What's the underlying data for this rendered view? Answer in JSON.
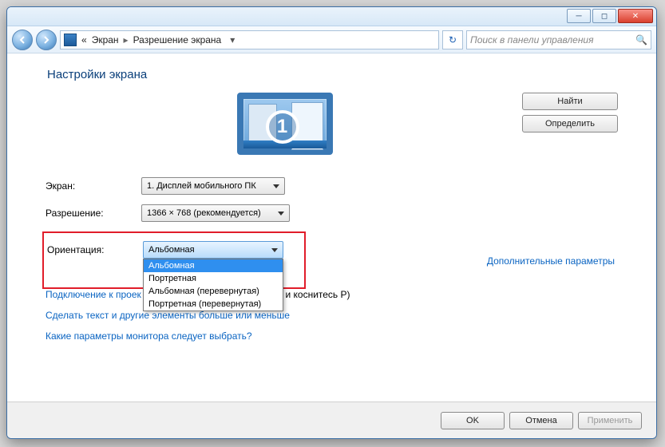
{
  "titlebar": {},
  "nav": {
    "breadcrumb_prefix": "«",
    "breadcrumb_1": "Экран",
    "breadcrumb_2": "Разрешение экрана",
    "search_placeholder": "Поиск в панели управления"
  },
  "page": {
    "title": "Настройки экрана",
    "monitor_number": "1",
    "buttons": {
      "find": "Найти",
      "detect": "Определить"
    },
    "labels": {
      "screen": "Экран:",
      "resolution": "Разрешение:",
      "orientation": "Ориентация:"
    },
    "dropdowns": {
      "screen_value": "1. Дисплей мобильного ПК",
      "resolution_value": "1366 × 768 (рекомендуется)",
      "orientation_value": "Альбомная",
      "orientation_options": [
        "Альбомная",
        "Портретная",
        "Альбомная (перевернутая)",
        "Портретная (перевернутая)"
      ],
      "orientation_selected_index": 0
    },
    "links": {
      "advanced": "Дополнительные параметры",
      "connect_prefix": "Подключение к проек",
      "connect_suffix": "и коснитесь P)",
      "bigger_text": "Сделать текст и другие элементы больше или меньше",
      "which_settings": "Какие параметры монитора следует выбрать?"
    }
  },
  "footer": {
    "ok": "OK",
    "cancel": "Отмена",
    "apply": "Применить"
  }
}
